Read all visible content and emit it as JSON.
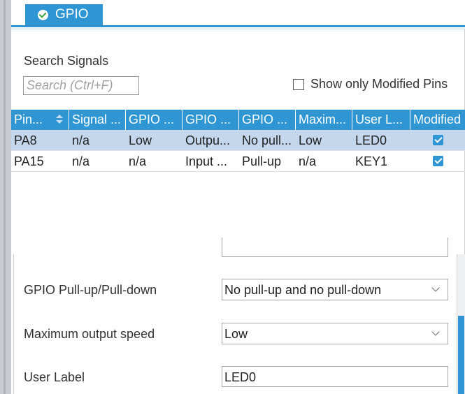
{
  "tab": {
    "label": "GPIO",
    "icon": "check-circle-icon"
  },
  "search": {
    "label": "Search Signals",
    "placeholder": "Search (Ctrl+F)"
  },
  "filter": {
    "modified_only_label": "Show only Modified Pins",
    "checked": false
  },
  "table": {
    "headers": [
      "Pin...",
      "Signal ...",
      "GPIO ...",
      "GPIO ...",
      "GPIO ...",
      "Maxim...",
      "User L...",
      "Modified"
    ],
    "rows": [
      {
        "cells": [
          "PA8",
          "n/a",
          "Low",
          "Outpu...",
          "No pull...",
          "Low",
          "LED0"
        ],
        "modified": true,
        "selected": true
      },
      {
        "cells": [
          "PA15",
          "n/a",
          "n/a",
          "Input ...",
          "Pull-up",
          "n/a",
          "KEY1"
        ],
        "modified": true,
        "selected": false
      }
    ]
  },
  "config": {
    "pull_label": "GPIO Pull-up/Pull-down",
    "pull_value": "No pull-up and no pull-down",
    "speed_label": "Maximum output speed",
    "speed_value": "Low",
    "user_label_label": "User Label",
    "user_label_value": "LED0"
  },
  "colors": {
    "accent": "#2f96d3",
    "selected_row": "#c4d7ec"
  }
}
